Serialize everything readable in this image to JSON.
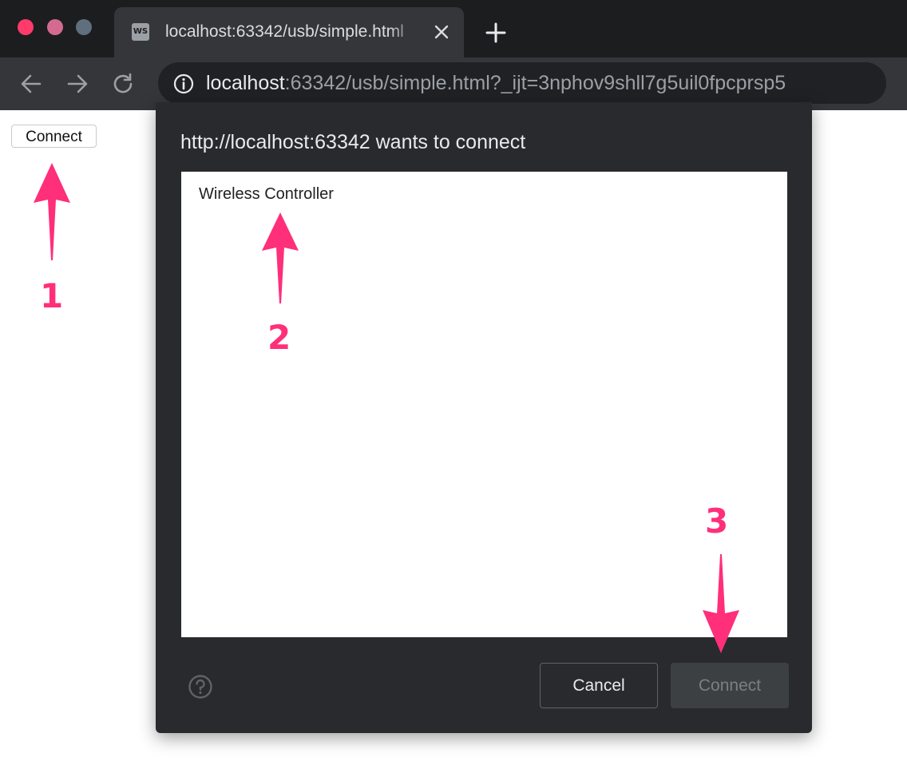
{
  "browser": {
    "tab": {
      "favicon_text": "WS",
      "title": "localhost:63342/usb/simple.html"
    },
    "address": {
      "host": "localhost",
      "rest": ":63342/usb/simple.html?_ijt=3nphov9shll7g5uil0fpcprsp5"
    }
  },
  "page": {
    "connect_label": "Connect"
  },
  "dialog": {
    "title": "http://localhost:63342 wants to connect",
    "devices": [
      "Wireless Controller"
    ],
    "cancel_label": "Cancel",
    "connect_label": "Connect"
  },
  "annotations": [
    "1",
    "2",
    "3"
  ],
  "colors": {
    "annotation": "#ff2f7a",
    "traffic_close": "#ff3b6b",
    "traffic_minimize": "#d56a8f",
    "traffic_zoom": "#5f6f7e",
    "dialog_background": "#292a2d"
  },
  "icons": [
    "back-arrow-icon",
    "forward-arrow-icon",
    "reload-icon",
    "info-icon",
    "close-tab-icon",
    "new-tab-icon",
    "help-icon"
  ]
}
